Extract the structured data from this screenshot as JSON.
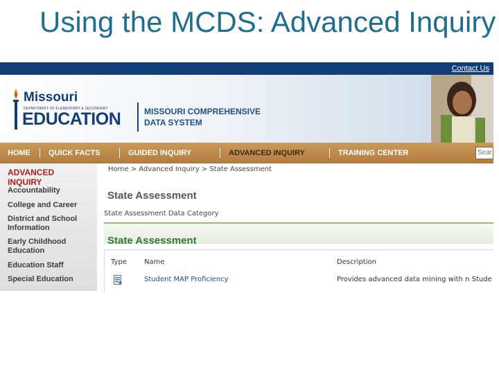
{
  "slide": {
    "title": "Using the MCDS: Advanced Inquiry"
  },
  "site": {
    "contact_link": "Contact Us",
    "logo_missouri": "Missouri",
    "logo_department": "DEPARTMENT OF ELEMENTARY & SECONDARY",
    "logo_education": "EDUCATION",
    "system_line1": "MISSOURI COMPREHENSIVE",
    "system_line2": "DATA SYSTEM"
  },
  "nav": {
    "items": [
      {
        "label": "HOME"
      },
      {
        "label": "QUICK FACTS"
      },
      {
        "label": "GUIDED INQUIRY"
      },
      {
        "label": "ADVANCED INQUIRY"
      },
      {
        "label": "TRAINING CENTER"
      }
    ],
    "search_placeholder": "Sear",
    "active_index": 3
  },
  "sidebar": {
    "heading_line1": "ADVANCED",
    "heading_line2": "INQUIRY",
    "items": [
      {
        "label": "Accountability"
      },
      {
        "label": "College and Career"
      },
      {
        "label": "District and School Information"
      },
      {
        "label": "Early Childhood Education"
      },
      {
        "label": "Education Staff"
      },
      {
        "label": "Special Education"
      }
    ]
  },
  "main": {
    "breadcrumb": "Home > Advanced Inquiry > State Assessment",
    "page_title": "State Assessment",
    "category_label": "State Assessment Data Category",
    "section_title": "State Assessment",
    "table": {
      "headers": [
        "Type",
        "Name",
        "Description"
      ],
      "rows": [
        {
          "name": "Student MAP Proficiency",
          "description": "Provides advanced data mining with n Stude"
        }
      ]
    }
  },
  "colors": {
    "title": "#1f6e8f",
    "top_bar": "#123e78",
    "nav_bar": "#b27a3c",
    "sidebar_heading": "#b01c1c",
    "section_title": "#2f7a32",
    "link": "#1a4fa0"
  }
}
